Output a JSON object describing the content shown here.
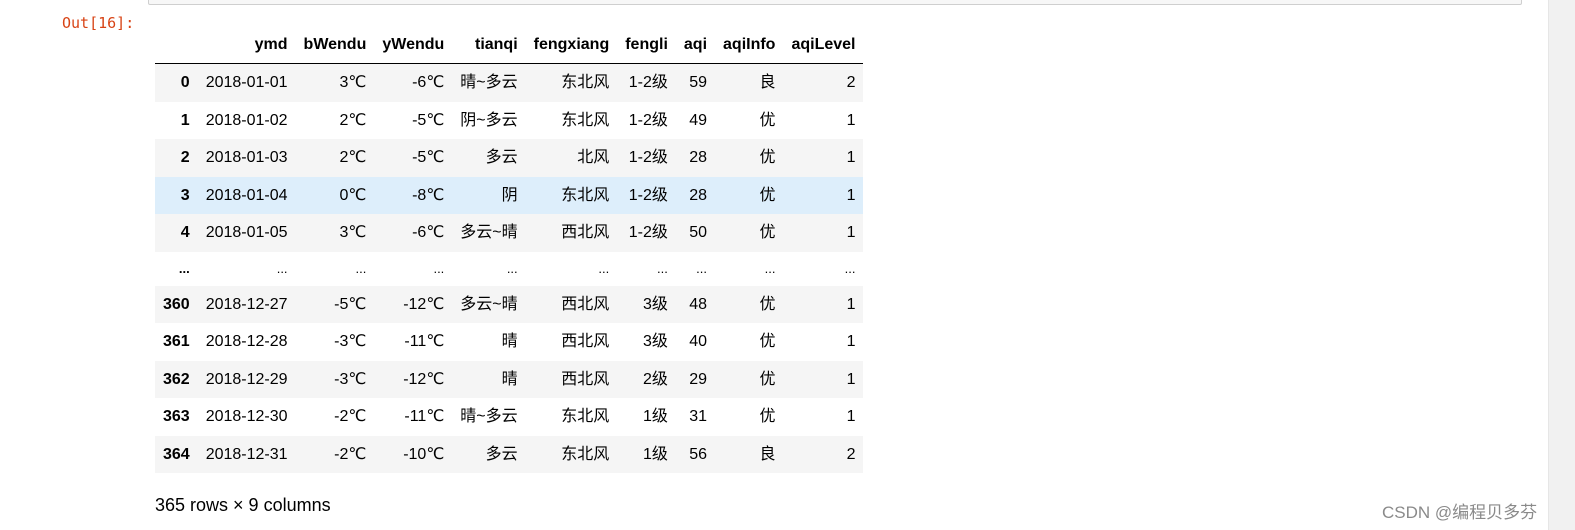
{
  "prompt": "Out[16]:",
  "table": {
    "columns": [
      "",
      "ymd",
      "bWendu",
      "yWendu",
      "tianqi",
      "fengxiang",
      "fengli",
      "aqi",
      "aqiInfo",
      "aqiLevel"
    ],
    "rows": [
      [
        "0",
        "2018-01-01",
        "3℃",
        "-6℃",
        "晴~多云",
        "东北风",
        "1-2级",
        "59",
        "良",
        "2"
      ],
      [
        "1",
        "2018-01-02",
        "2℃",
        "-5℃",
        "阴~多云",
        "东北风",
        "1-2级",
        "49",
        "优",
        "1"
      ],
      [
        "2",
        "2018-01-03",
        "2℃",
        "-5℃",
        "多云",
        "北风",
        "1-2级",
        "28",
        "优",
        "1"
      ],
      [
        "3",
        "2018-01-04",
        "0℃",
        "-8℃",
        "阴",
        "东北风",
        "1-2级",
        "28",
        "优",
        "1"
      ],
      [
        "4",
        "2018-01-05",
        "3℃",
        "-6℃",
        "多云~晴",
        "西北风",
        "1-2级",
        "50",
        "优",
        "1"
      ],
      [
        "...",
        "...",
        "...",
        "...",
        "...",
        "...",
        "...",
        "...",
        "...",
        "..."
      ],
      [
        "360",
        "2018-12-27",
        "-5℃",
        "-12℃",
        "多云~晴",
        "西北风",
        "3级",
        "48",
        "优",
        "1"
      ],
      [
        "361",
        "2018-12-28",
        "-3℃",
        "-11℃",
        "晴",
        "西北风",
        "3级",
        "40",
        "优",
        "1"
      ],
      [
        "362",
        "2018-12-29",
        "-3℃",
        "-12℃",
        "晴",
        "西北风",
        "2级",
        "29",
        "优",
        "1"
      ],
      [
        "363",
        "2018-12-30",
        "-2℃",
        "-11℃",
        "晴~多云",
        "东北风",
        "1级",
        "31",
        "优",
        "1"
      ],
      [
        "364",
        "2018-12-31",
        "-2℃",
        "-10℃",
        "多云",
        "东北风",
        "1级",
        "56",
        "良",
        "2"
      ]
    ],
    "hover_row": "3"
  },
  "shape_text": "365 rows × 9 columns",
  "watermark": "CSDN @编程贝多芬"
}
